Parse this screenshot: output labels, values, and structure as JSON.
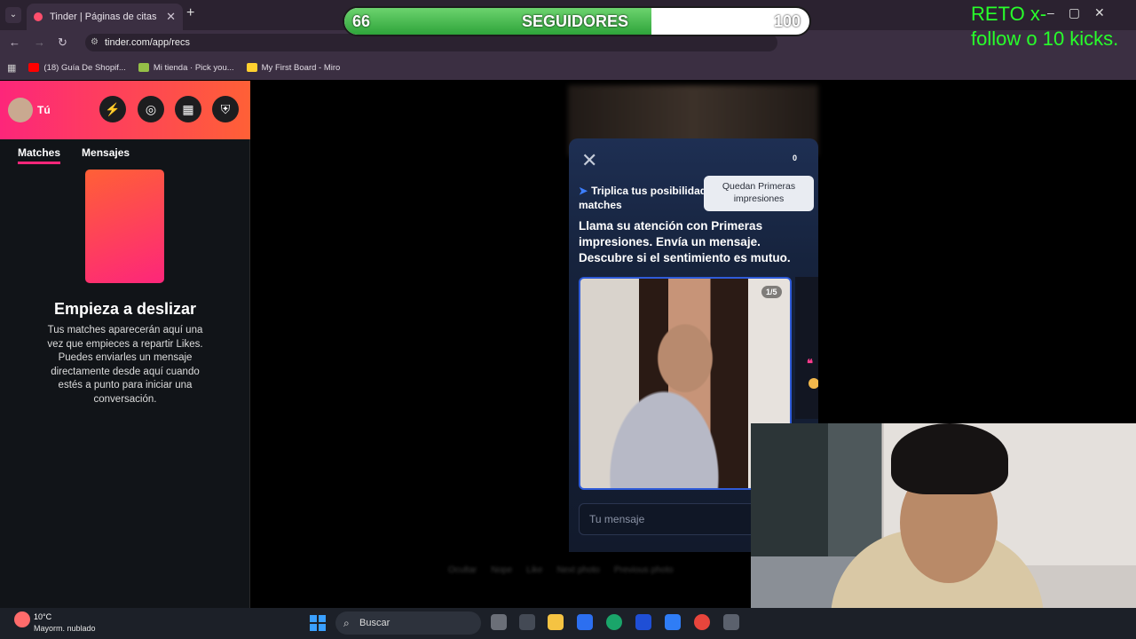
{
  "browser": {
    "tab_title": "Tinder | Páginas de citas",
    "tab_close": "✕",
    "new_tab": "+",
    "tab_menu": "⌄",
    "url": "tinder.com/app/recs",
    "nav_back": "←",
    "nav_forward": "→",
    "nav_reload": "↻",
    "window_controls": "–▢✕",
    "bookmarks": [
      {
        "label": "(18) Guía De Shopif...",
        "color": "#ff0000"
      },
      {
        "label": "Mi tienda · Pick you...",
        "color": "#95bf47"
      },
      {
        "label": "My First Board - Miro",
        "color": "#ffd02f"
      }
    ]
  },
  "overlay": {
    "progress_current": "66",
    "progress_label": "SEGUIDORES",
    "progress_max": "100",
    "progress_fraction": 0.66,
    "challenge_line1": "RETO  x-",
    "challenge_line2": "follow o 10 kicks."
  },
  "sidebar": {
    "user_label": "Tú",
    "icons": {
      "boost": "⚡",
      "explore": "◎",
      "passport": "▦",
      "safety": "⛨"
    },
    "tabs": [
      "Matches",
      "Mensajes"
    ],
    "empty_title": "Empieza a deslizar",
    "empty_desc": "Tus matches aparecerán aquí una vez que empieces a repartir Likes. Puedes enviarles un mensaje directamente desde aquí cuando estés a punto para iniciar una conversación."
  },
  "modal": {
    "close": "✕",
    "counter": "0",
    "tooltip": "Quedan Primeras impresiones",
    "subtitle": "Triplica tus posibilidades de hacer matches",
    "subtitle_icon": "➤",
    "body": "Llama su atención con Primeras impresiones. Envía un mensaje. Descubre si el sentimiento es mutuo.",
    "photo_counter": "1/5",
    "quote_glyph": "❝",
    "message_placeholder": "Tu mensaje"
  },
  "background_hints": [
    "Ocultar",
    "Nope",
    "Like",
    "Next photo",
    "Previous photo"
  ],
  "taskbar": {
    "temperature": "10°C",
    "weather": "Mayorm. nublado",
    "search": "Buscar",
    "search_icon": "⌕"
  }
}
